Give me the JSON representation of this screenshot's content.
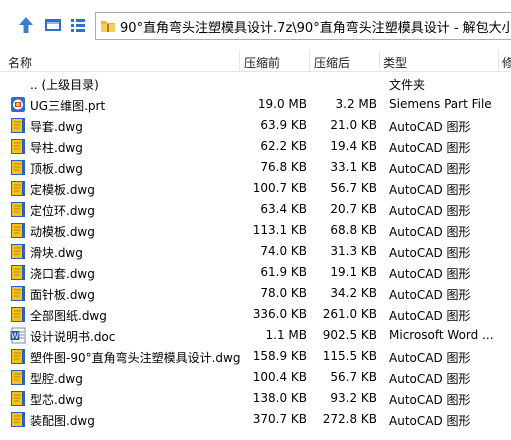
{
  "toolbar": {
    "address": "90°直角弯头注塑模具设计.7z\\90°直角弯头注塑模具设计 - 解包大小为 21"
  },
  "columns": {
    "name": "名称",
    "compressed": "压缩前",
    "original": "压缩后",
    "type": "类型",
    "modified": "修"
  },
  "files": [
    {
      "name": ".. (上级目录)",
      "compressed": "",
      "original": "",
      "type": "文件夹",
      "icon": "up-folder-icon"
    },
    {
      "name": "UG三维图.prt",
      "compressed": "19.0 MB",
      "original": "3.2 MB",
      "type": "Siemens Part File",
      "icon": "ug-part-icon"
    },
    {
      "name": "导套.dwg",
      "compressed": "63.9 KB",
      "original": "21.0 KB",
      "type": "AutoCAD 图形",
      "icon": "dwg-icon"
    },
    {
      "name": "导柱.dwg",
      "compressed": "62.2 KB",
      "original": "19.4 KB",
      "type": "AutoCAD 图形",
      "icon": "dwg-icon"
    },
    {
      "name": "顶板.dwg",
      "compressed": "76.8 KB",
      "original": "33.1 KB",
      "type": "AutoCAD 图形",
      "icon": "dwg-icon"
    },
    {
      "name": "定模板.dwg",
      "compressed": "100.7 KB",
      "original": "56.7 KB",
      "type": "AutoCAD 图形",
      "icon": "dwg-icon"
    },
    {
      "name": "定位环.dwg",
      "compressed": "63.4 KB",
      "original": "20.7 KB",
      "type": "AutoCAD 图形",
      "icon": "dwg-icon"
    },
    {
      "name": "动模板.dwg",
      "compressed": "113.1 KB",
      "original": "68.8 KB",
      "type": "AutoCAD 图形",
      "icon": "dwg-icon"
    },
    {
      "name": "滑块.dwg",
      "compressed": "74.0 KB",
      "original": "31.3 KB",
      "type": "AutoCAD 图形",
      "icon": "dwg-icon"
    },
    {
      "name": "浇口套.dwg",
      "compressed": "61.9 KB",
      "original": "19.1 KB",
      "type": "AutoCAD 图形",
      "icon": "dwg-icon"
    },
    {
      "name": "面针板.dwg",
      "compressed": "78.0 KB",
      "original": "34.2 KB",
      "type": "AutoCAD 图形",
      "icon": "dwg-icon"
    },
    {
      "name": "全部图纸.dwg",
      "compressed": "336.0 KB",
      "original": "261.0 KB",
      "type": "AutoCAD 图形",
      "icon": "dwg-icon"
    },
    {
      "name": "设计说明书.doc",
      "compressed": "1.1 MB",
      "original": "902.5 KB",
      "type": "Microsoft Word ...",
      "icon": "word-doc-icon"
    },
    {
      "name": "塑件图-90°直角弯头注塑模具设计.dwg",
      "compressed": "158.9 KB",
      "original": "115.5 KB",
      "type": "AutoCAD 图形",
      "icon": "dwg-icon"
    },
    {
      "name": "型腔.dwg",
      "compressed": "100.4 KB",
      "original": "56.7 KB",
      "type": "AutoCAD 图形",
      "icon": "dwg-icon"
    },
    {
      "name": "型芯.dwg",
      "compressed": "138.0 KB",
      "original": "93.2 KB",
      "type": "AutoCAD 图形",
      "icon": "dwg-icon"
    },
    {
      "name": "装配图.dwg",
      "compressed": "370.7 KB",
      "original": "272.8 KB",
      "type": "AutoCAD 图形",
      "icon": "dwg-icon"
    }
  ],
  "colors": {
    "up_arrow": "#3a7bd5",
    "dwg_yellow": "#f2c318",
    "dwg_blue": "#2b62c2",
    "word_blue": "#2b579a",
    "folder_yellow": "#f5c542"
  }
}
